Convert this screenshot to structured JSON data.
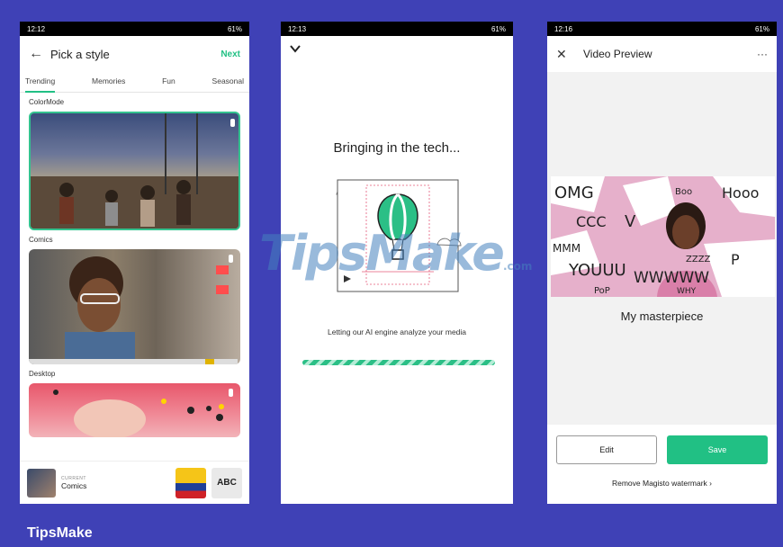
{
  "screen1": {
    "status_time": "12:12",
    "status_right": "61%",
    "title": "Pick a style",
    "next_label": "Next",
    "tabs": [
      "Trending",
      "Memories",
      "Fun",
      "Seasonal"
    ],
    "sections": [
      "ColorMode",
      "Comics",
      "Desktop"
    ],
    "current_label": "CURRENT",
    "current_name": "Comics",
    "abc_label": "ABC"
  },
  "screen2": {
    "status_time": "12:13",
    "status_right": "61%",
    "heading": "Bringing in the tech...",
    "subtext": "Letting our AI engine analyze your media",
    "progress": 1.0
  },
  "screen3": {
    "status_time": "12:16",
    "status_right": "61%",
    "title": "Video Preview",
    "more": "···",
    "caption": "My masterpiece",
    "edit_label": "Edit",
    "save_label": "Save",
    "remove_label": "Remove Magisto watermark ›",
    "comic_words": [
      "OMG",
      "Boo",
      "Hooo",
      "CCC",
      "V",
      "MMM",
      "YOUUU",
      "ZZZZ",
      "WWWWW",
      "PoP",
      "WHY",
      "P"
    ]
  },
  "watermark": {
    "main": "TipsMake",
    "suffix": ".com"
  },
  "brand": "TipsMake",
  "colors": {
    "frame": "#3f41b6",
    "accent": "#21c084"
  }
}
